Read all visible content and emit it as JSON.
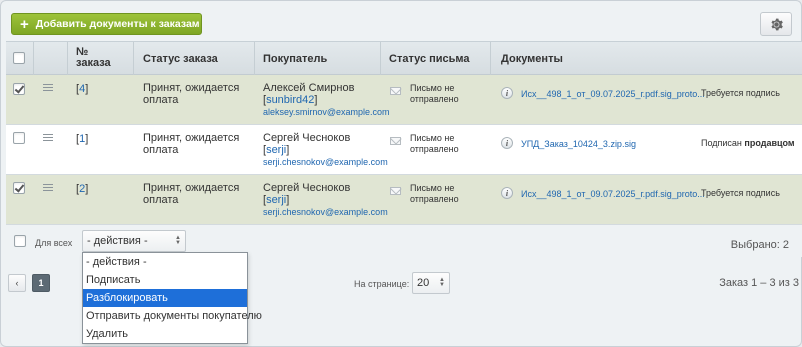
{
  "toolbar": {
    "add_documents_label": "Добавить документы к заказам",
    "settings_icon": "gear-icon"
  },
  "table": {
    "headers": {
      "order_no": [
        "№",
        "заказа"
      ],
      "status": "Статус заказа",
      "buyer": "Покупатель",
      "letter_status": "Статус письма",
      "documents": "Документы"
    },
    "rows": [
      {
        "checked": true,
        "order_no": "[4]",
        "order_link": "4",
        "status": [
          "Принят, ожидается",
          "оплата"
        ],
        "buyer_name": "Алексей Смирнов",
        "buyer_login": "sunbird42",
        "buyer_email": "aleksey.smirnov@example.com",
        "letter_status": [
          "Письмо не",
          "отправлено"
        ],
        "doc": "Исх__498_1_от_09.07.2025_г.pdf.sig_proto...",
        "sign_status": "Требуется подпись",
        "sign_status_bold": ""
      },
      {
        "checked": false,
        "order_no": "[1]",
        "order_link": "1",
        "status": [
          "Принят, ожидается",
          "оплата"
        ],
        "buyer_name": "Сергей Чесноков",
        "buyer_login": "serji",
        "buyer_email": "serji.chesnokov@example.com",
        "letter_status": [
          "Письмо не",
          "отправлено"
        ],
        "doc": "УПД_Заказ_10424_3.zip.sig",
        "sign_status": "Подписан",
        "sign_status_bold": "продавцом"
      },
      {
        "checked": true,
        "order_no": "[2]",
        "order_link": "2",
        "status": [
          "Принят, ожидается",
          "оплата"
        ],
        "buyer_name": "Сергей Чесноков",
        "buyer_login": "serji",
        "buyer_email": "serji.chesnokov@example.com",
        "letter_status": [
          "Письмо не",
          "отправлено"
        ],
        "doc": "Исх__498_1_от_09.07.2025_г.pdf.sig_proto...",
        "sign_status": "Требуется подпись",
        "sign_status_bold": ""
      }
    ]
  },
  "footer": {
    "select_all_label": "Для всех",
    "actions_value": "- действия -",
    "selected_label": "Выбрано: 2"
  },
  "actions_dropdown": {
    "options": [
      "- действия -",
      "Подписать",
      "Разблокировать",
      "Отправить документы покупателю",
      "Удалить"
    ],
    "highlighted_index": 2
  },
  "pager": {
    "prev": "‹",
    "current_page": "1",
    "next": "›",
    "per_page_label": "На странице:",
    "per_page_value": "20",
    "range_label": "Заказ 1 – 3 из 3"
  },
  "colors": {
    "accent_green": "#8bb52e",
    "selected_row": "#e0e5d3",
    "link": "#2067b0",
    "highlight": "#1e6fd9"
  }
}
